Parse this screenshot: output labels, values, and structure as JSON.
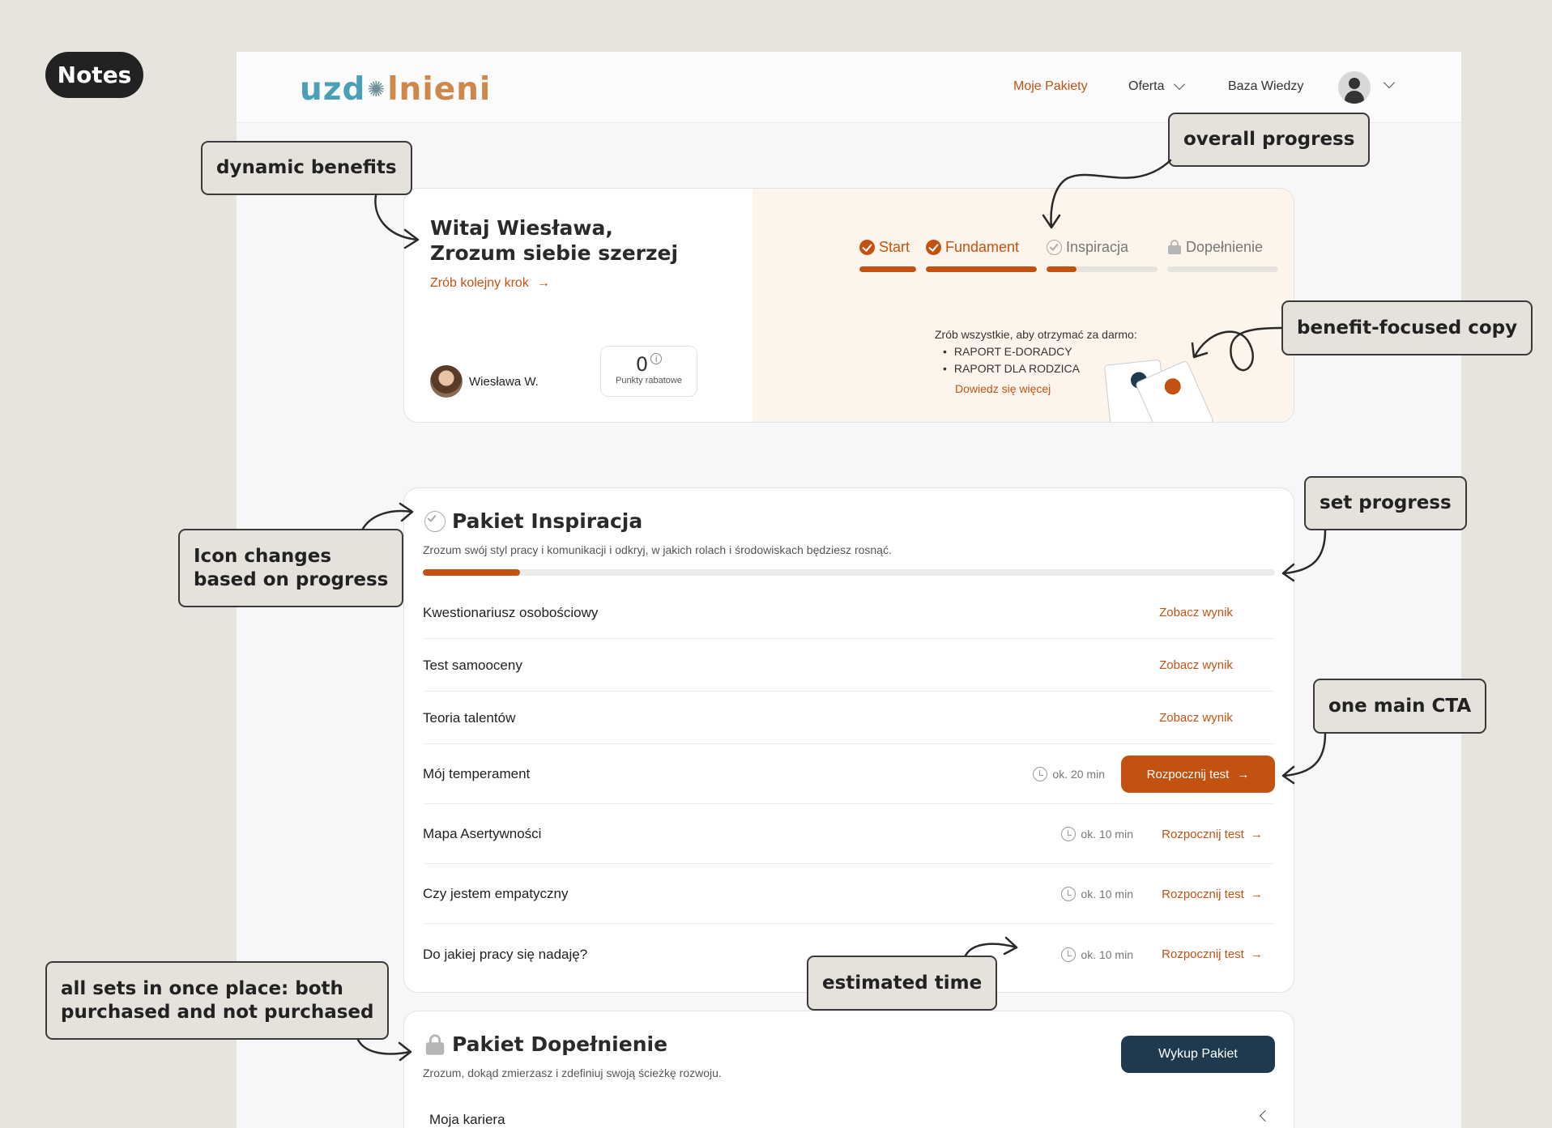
{
  "notes_tag": "Notes",
  "header": {
    "logo_a": "uzd",
    "logo_b": "lnieni",
    "nav": [
      "Moje Pakiety",
      "Oferta",
      "Baza Wiedzy"
    ]
  },
  "hero": {
    "greeting": "Witaj Wiesława,",
    "headline": "Zrozum siebie szerzej",
    "next_step": "Zrób kolejny krok",
    "user_name": "Wiesława W.",
    "points_value": "0",
    "points_label": "Punkty rabatowe",
    "steps": [
      {
        "label": "Start",
        "state": "done",
        "progress": 1.0
      },
      {
        "label": "Fundament",
        "state": "done",
        "progress": 1.0
      },
      {
        "label": "Inspiracja",
        "state": "active",
        "progress": 0.27
      },
      {
        "label": "Dopełnienie",
        "state": "locked",
        "progress": 0
      }
    ],
    "benefits_intro": "Zrób wszystkie, aby otrzymać za darmo:",
    "benefits": [
      "RAPORT E-DORADCY",
      "RAPORT DLA RODZICA"
    ],
    "learn_more": "Dowiedz się więcej"
  },
  "package1": {
    "title": "Pakiet Inspiracja",
    "desc": "Zrozum swój styl pracy i komunikacji i odkryj, w jakich rolach i środowiskach będziesz rosnąć.",
    "progress": 0.114,
    "done_rows": [
      {
        "name": "Kwestionariusz osobościowy",
        "action": "Zobacz wynik"
      },
      {
        "name": "Test samooceny",
        "action": "Zobacz wynik"
      },
      {
        "name": "Teoria talentów",
        "action": "Zobacz wynik"
      }
    ],
    "main_row": {
      "name": "Mój temperament",
      "time": "ok. 20 min",
      "action": "Rozpocznij test"
    },
    "todo_rows": [
      {
        "name": "Mapa Asertywności",
        "time": "ok. 10 min",
        "action": "Rozpocznij test"
      },
      {
        "name": "Czy jestem empatyczny",
        "time": "ok. 10 min",
        "action": "Rozpocznij test"
      },
      {
        "name": "Do jakiej pracy się nadaję?",
        "time": "ok. 10 min",
        "action": "Rozpocznij test"
      }
    ]
  },
  "package2": {
    "title": "Pakiet Dopełnienie",
    "desc": "Zrozum, dokąd zmierzasz i zdefiniuj swoją ścieżkę rozwoju.",
    "buy": "Wykup Pakiet",
    "first_row": "Moja kariera"
  },
  "annotations": {
    "dynamic_benefits": "dynamic benefits",
    "overall_progress": "overall progress",
    "benefit_copy": "benefit-focused copy",
    "icon_changes_1": "Icon changes",
    "icon_changes_2": "based on progress",
    "set_progress": "set progress",
    "main_cta": "one main CTA",
    "estimated_time": "estimated time",
    "all_sets_1": "all sets in once place: both",
    "all_sets_2": "purchased and not purchased"
  },
  "colors": {
    "accent": "#c35212",
    "dark_button": "#1f3a4f",
    "logo_teal": "#4aa0b5",
    "logo_orange": "#d0884a"
  }
}
